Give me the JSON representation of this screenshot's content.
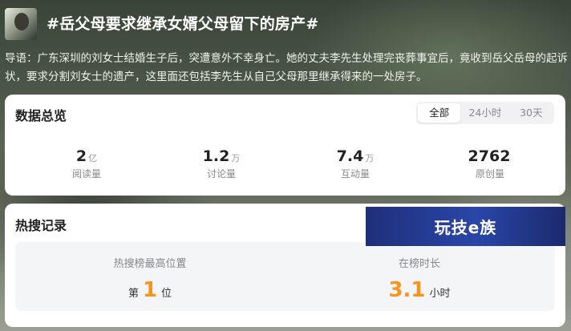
{
  "header": {
    "title": "#岳父母要求继承女婿父母留下的房产#",
    "intro": "导语：广东深圳的刘女士结婚生子后，突遭意外不幸身亡。她的丈夫李先生处理完丧葬事宜后，竟收到岳父岳母的起诉状，要求分割刘女士的遗产，这里面还包括李先生从自己父母那里继承得来的一处房子。"
  },
  "overview": {
    "title": "数据总览",
    "tabs": [
      "全部",
      "24小时",
      "30天"
    ],
    "active_tab": "全部",
    "stats": [
      {
        "value": "2",
        "unit": "亿",
        "label": "阅读量"
      },
      {
        "value": "1.2",
        "unit": "万",
        "label": "讨论量"
      },
      {
        "value": "7.4",
        "unit": "万",
        "label": "互动量"
      },
      {
        "value": "2762",
        "unit": "",
        "label": "原创量"
      }
    ]
  },
  "hot": {
    "title": "热搜记录",
    "banner": "玩技e族",
    "peak_label": "热搜榜最高位置",
    "peak_prefix": "第",
    "peak_value": "1",
    "peak_suffix": "位",
    "duration_label": "在榜时长",
    "duration_value": "3.1",
    "duration_unit": "小时"
  },
  "colors": {
    "accent_orange": "#f7941d",
    "banner_blue": "#2a46a8"
  }
}
